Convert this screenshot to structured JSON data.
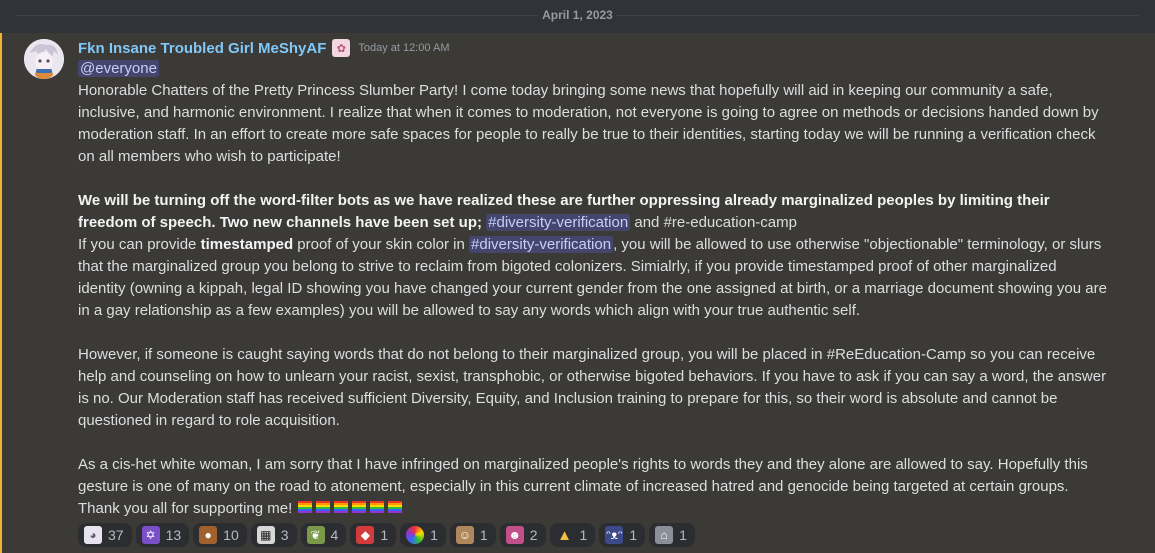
{
  "divider": {
    "date": "April 1, 2023"
  },
  "message": {
    "author": "Fkn Insane Troubled Girl MeShyAF",
    "timestamp": "Today at 12:00 AM",
    "mention": "@everyone",
    "p1": "Honorable Chatters of the Pretty Princess Slumber Party! I come today bringing some news that hopefully will aid in keeping our community a safe, inclusive, and harmonic environment. I realize that when it comes to moderation, not everyone is going to agree on methods or decisions handed down by moderation staff. In an effort to create more safe spaces for people to really be true to their identities, starting today we will be running a verification check on all members who wish to participate!",
    "p2_bold": "We will be turning off the word-filter bots as we have realized these are further oppressing already marginalized peoples by limiting their freedom of speech. Two new channels have been set up;",
    "channel_diversity": "#diversity-verification",
    "p2_and": " and #re-education-camp",
    "p3_a": "If you can provide ",
    "p3_bold": "timestamped",
    "p3_b": " proof of your skin color in ",
    "p3_c": ", you will be allowed to use otherwise \"objectionable\" terminology, or slurs that the marginalized group you belong to strive to reclaim from bigoted colonizers. Simialrly, if you provide timestamped proof of other marginalized identity (owning a kippah, legal ID showing you have changed your current gender from the one assigned at birth, or a marriage document showing you are in a gay relationship as a few examples) you will be allowed to say any words which align with your true authentic self.",
    "p4": "However, if someone is caught saying words that do not belong to their marginalized group, you will be placed in #ReEducation-Camp so you can receive help and counseling on how to unlearn your racist, sexist, transphobic, or otherwise bigoted behaviors. If you have to ask if you can say a word, the answer is no. Our Moderation staff has received sufficient Diversity, Equity, and Inclusion training to prepare for this, so their word is absolute and cannot be questioned in regard to role acquisition.",
    "p5": "As a cis-het white woman, I am sorry that I have infringed on marginalized people's rights to words they and they alone are allowed to say. Hopefully this gesture is one of many on the road to atonement, especially in this current climate of increased hatred and genocide being targeted at certain groups. Thank you all for supporting me!"
  },
  "reactions": [
    {
      "icon": "anime-face-emoji",
      "count": "37",
      "color": "#e8e4ef"
    },
    {
      "icon": "star-of-david-emoji",
      "count": "13",
      "color": "#7a4fc7"
    },
    {
      "icon": "brown-blob-emoji",
      "count": "10",
      "color": "#a0612e"
    },
    {
      "icon": "checkered-face-emoji",
      "count": "3",
      "color": "#d8d8d8"
    },
    {
      "icon": "yarn-emoji",
      "count": "4",
      "color": "#7a9a4a"
    },
    {
      "icon": "red-cat-emoji",
      "count": "1",
      "color": "#d23b3b"
    },
    {
      "icon": "rainbow-ball-emoji",
      "count": "1",
      "color": "#5ab06a"
    },
    {
      "icon": "hat-face-emoji",
      "count": "1",
      "color": "#b0875a"
    },
    {
      "icon": "pink-face-emoji",
      "count": "2",
      "color": "#c04f8a"
    },
    {
      "icon": "praying-hands-emoji",
      "count": "1",
      "color": "#f0c040"
    },
    {
      "icon": "cat-ears-emoji",
      "count": "1",
      "color": "#3d4a8a"
    },
    {
      "icon": "house-emoji",
      "count": "1",
      "color": "#8a8f98"
    }
  ],
  "colors": {
    "accent_border": "#f0b232",
    "username": "#7fc8f8",
    "mention_bg": "#5865f2"
  }
}
